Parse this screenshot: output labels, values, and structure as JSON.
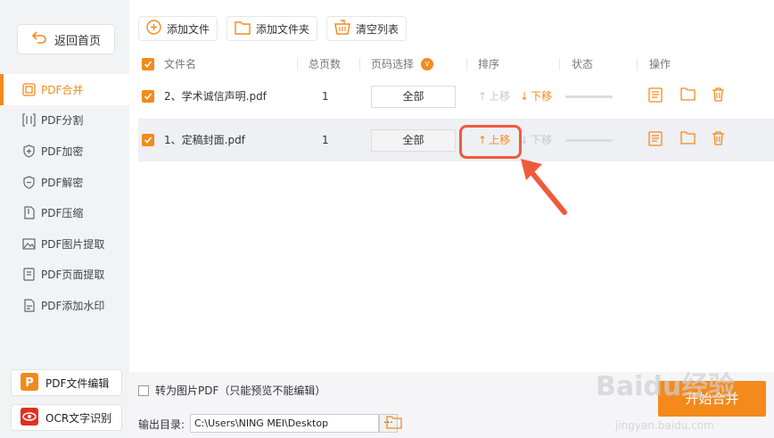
{
  "sidebar": {
    "back_label": "返回首页",
    "items": [
      {
        "label": "PDF合并",
        "active": true,
        "icon": "merge-icon"
      },
      {
        "label": "PDF分割",
        "icon": "split-icon"
      },
      {
        "label": "PDF加密",
        "icon": "shield-plus-icon"
      },
      {
        "label": "PDF解密",
        "icon": "shield-minus-icon"
      },
      {
        "label": "PDF压缩",
        "icon": "compress-icon"
      },
      {
        "label": "PDF图片提取",
        "icon": "image-icon"
      },
      {
        "label": "PDF页面提取",
        "icon": "page-icon"
      },
      {
        "label": "PDF添加水印",
        "icon": "watermark-icon"
      }
    ],
    "bottom": [
      {
        "label": "PDF文件编辑",
        "icon": "pdf-edit-app-icon"
      },
      {
        "label": "OCR文字识别",
        "icon": "ocr-eye-icon"
      }
    ]
  },
  "toolbar": {
    "add_file": "添加文件",
    "add_folder": "添加文件夹",
    "clear_list": "清空列表"
  },
  "table": {
    "headers": {
      "filename": "文件名",
      "pages": "总页数",
      "page_select": "页码选择",
      "sort": "排序",
      "status": "状态",
      "actions": "操作"
    },
    "rows": [
      {
        "name": "2、学术诚信声明.pdf",
        "pages": "1",
        "page_select": "全部",
        "up": "上移",
        "down": "下移",
        "checked": true,
        "selected": false,
        "up_enabled": false,
        "down_enabled": true
      },
      {
        "name": "1、定稿封面.pdf",
        "pages": "1",
        "page_select": "全部",
        "up": "上移",
        "down": "下移",
        "checked": true,
        "selected": true,
        "up_enabled": true,
        "down_enabled": false
      }
    ]
  },
  "bottom": {
    "convert_label": "转为图片PDF（只能预览不能编辑）",
    "output_label": "输出目录:",
    "output_path": "C:\\Users\\NING MEI\\Desktop",
    "browse": "···",
    "start": "开始合并"
  },
  "watermark": {
    "brand": "Baidu经验",
    "url": "jingyan.baidu.com"
  },
  "colors": {
    "accent": "#f38a1b",
    "highlight": "#f05a3c"
  }
}
